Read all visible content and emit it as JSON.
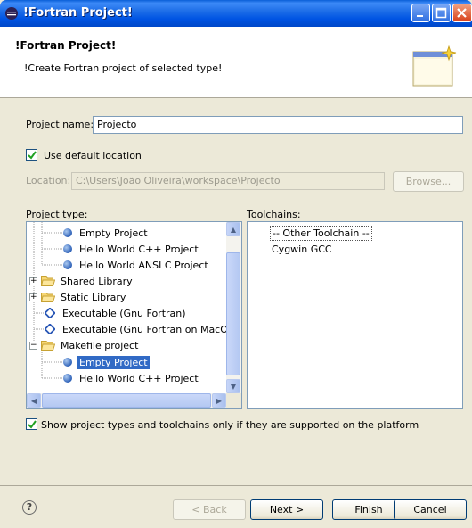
{
  "window": {
    "title": "!Fortran Project!"
  },
  "banner": {
    "title": "!Fortran Project!",
    "description": "!Create Fortran project of selected type!"
  },
  "project_name": {
    "label": "Project name:",
    "value": "Projecto"
  },
  "use_default_location": {
    "label": "Use default location",
    "checked": true
  },
  "location": {
    "label": "Location:",
    "value": "C:\\Users\\João Oliveira\\workspace\\Projecto",
    "browse_label": "Browse..."
  },
  "project_type": {
    "label": "Project type:",
    "items": [
      {
        "label": "Empty Project",
        "icon": "circle-icon"
      },
      {
        "label": "Hello World C++ Project",
        "icon": "circle-icon"
      },
      {
        "label": "Hello World ANSI C Project",
        "icon": "circle-icon"
      },
      {
        "label": "Shared Library",
        "icon": "folder-icon",
        "expander": "+"
      },
      {
        "label": "Static Library",
        "icon": "folder-icon",
        "expander": "+"
      },
      {
        "label": "Executable (Gnu Fortran)",
        "icon": "diamond-icon"
      },
      {
        "label": "Executable (Gnu Fortran on MacOS",
        "icon": "diamond-icon"
      },
      {
        "label": "Makefile project",
        "icon": "folder-icon",
        "expander": "−"
      },
      {
        "label": "Empty Project",
        "icon": "circle-icon",
        "selected": true
      },
      {
        "label": "Hello World C++ Project",
        "icon": "circle-icon"
      }
    ]
  },
  "toolchains": {
    "label": "Toolchains:",
    "items": [
      "-- Other Toolchain --",
      "Cygwin GCC"
    ]
  },
  "show_supported": {
    "label": "Show project types and toolchains only if they are supported on the platform",
    "checked": true
  },
  "footer": {
    "back_label": "< Back",
    "next_label": "Next >",
    "finish_label": "Finish",
    "cancel_label": "Cancel"
  }
}
